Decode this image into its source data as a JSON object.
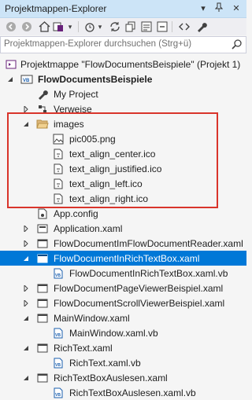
{
  "window": {
    "title": "Projektmappen-Explorer"
  },
  "search": {
    "placeholder": "Projektmappen-Explorer durchsuchen (Strg+ü)"
  },
  "tree": {
    "solution": "Projektmappe \"FlowDocumentsBeispiele\" (Projekt 1)",
    "project": "FlowDocumentsBeispiele",
    "my_project": "My Project",
    "verweise": "Verweise",
    "images": "images",
    "files": {
      "pic": "pic005.png",
      "center": "text_align_center.ico",
      "justified": "text_align_justified.ico",
      "left": "text_align_left.ico",
      "right": "text_align_right.ico"
    },
    "app_config": "App.config",
    "application": "Application.xaml",
    "reader": "FlowDocumentImFlowDocumentReader.xaml",
    "richtextbox": "FlowDocumentInRichTextBox.xaml",
    "richtextbox_vb": "FlowDocumentInRichTextBox.xaml.vb",
    "pageviewer": "FlowDocumentPageViewerBeispiel.xaml",
    "scrollviewer": "FlowDocumentScrollViewerBeispiel.xaml",
    "mainwindow": "MainWindow.xaml",
    "mainwindow_vb": "MainWindow.xaml.vb",
    "richtext": "RichText.xaml",
    "richtext_vb": "RichText.xaml.vb",
    "auslesen": "RichTextBoxAuslesen.xaml",
    "auslesen_vb": "RichTextBoxAuslesen.xaml.vb"
  },
  "colors": {
    "selection": "#0078d7",
    "highlight_border": "#d9342b",
    "folder": "#dcb67a",
    "vb": "#1b5fae"
  }
}
